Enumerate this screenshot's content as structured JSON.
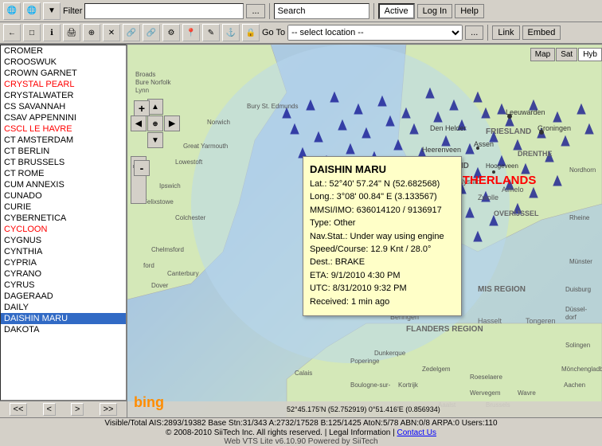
{
  "toolbar1": {
    "filter_label": "Filter",
    "filter_placeholder": "",
    "dots_btn": "...",
    "search_label": "Search",
    "active_btn": "Active",
    "login_btn": "Log In",
    "help_btn": "Help"
  },
  "toolbar2": {
    "goto_label": "Go To",
    "location_placeholder": "-- select location --",
    "dots_btn": "...",
    "link_btn": "Link",
    "embed_btn": "Embed"
  },
  "sidebar": {
    "items": [
      {
        "label": "CROMER",
        "class": ""
      },
      {
        "label": "CROOSWUK",
        "class": ""
      },
      {
        "label": "CROWN GARNET",
        "class": ""
      },
      {
        "label": "CRYSTAL PEARL",
        "class": "red"
      },
      {
        "label": "CRYSTALWATER",
        "class": ""
      },
      {
        "label": "CS SAVANNAH",
        "class": ""
      },
      {
        "label": "CSAV APPENNINI",
        "class": ""
      },
      {
        "label": "CSCL LE HAVRE",
        "class": "red"
      },
      {
        "label": "CT AMSTERDAM",
        "class": ""
      },
      {
        "label": "CT BERLIN",
        "class": ""
      },
      {
        "label": "CT BRUSSELS",
        "class": ""
      },
      {
        "label": "CT ROME",
        "class": ""
      },
      {
        "label": "CUM ANNEXIS",
        "class": ""
      },
      {
        "label": "CUNADO",
        "class": ""
      },
      {
        "label": "CURIE",
        "class": ""
      },
      {
        "label": "CYBERNETICA",
        "class": ""
      },
      {
        "label": "CYCLOON",
        "class": "red"
      },
      {
        "label": "CYGNUS",
        "class": ""
      },
      {
        "label": "CYNTHIA",
        "class": ""
      },
      {
        "label": "CYPRIA",
        "class": ""
      },
      {
        "label": "CYRANO",
        "class": ""
      },
      {
        "label": "CYRUS",
        "class": ""
      },
      {
        "label": "DAGERAAD",
        "class": ""
      },
      {
        "label": "DAILY",
        "class": ""
      },
      {
        "label": "DAISHIN MARU",
        "class": "selected"
      },
      {
        "label": "DAKOTA",
        "class": ""
      }
    ],
    "nav_buttons": [
      "<<",
      "<",
      ">",
      ">>"
    ]
  },
  "popup": {
    "title": "DAISHIN MARU",
    "lat": "Lat.: 52°40' 57.24\" N (52.682568)",
    "long": "Long.: 3°08' 00.84\" E (3.133567)",
    "mmsi": "MMSI/IMO: 636014120 / 9136917",
    "type": "Type: Other",
    "nav_stat": "Nav.Stat.: Under way using engine",
    "speed": "Speed/Course: 12.9 Knt / 28.0°",
    "dest": "Dest.: BRAKE",
    "eta": "ETA: 9/1/2010 4:30 PM",
    "utc": "UTC: 8/31/2010 9:32 PM",
    "received": "Received: 1 min ago"
  },
  "map": {
    "type_buttons": [
      "Map",
      "Sat",
      "Hyb"
    ],
    "active_type": "Hyb",
    "country_label": "NETHERLANDS",
    "zoom_in": "+",
    "zoom_out": "-"
  },
  "statusbar": {
    "line1": "Visible/Total AIS:2893/19382  Base Stn:31/343  A:2732/17528  B:125/1425  AtoN:5/78  ABN:0/8  ARPA:0  Users:110",
    "line2_prefix": "© 2008-2010 SiiTech Inc. All rights reserved.  |  Legal Information  |  ",
    "contact_link": "Contact Us",
    "line3": "Web VTS Lite v6.10.90  Powered by SiiTech"
  },
  "coords_display": "52°45.175'N (52.752919)   0°51.416'E (0.856934)"
}
